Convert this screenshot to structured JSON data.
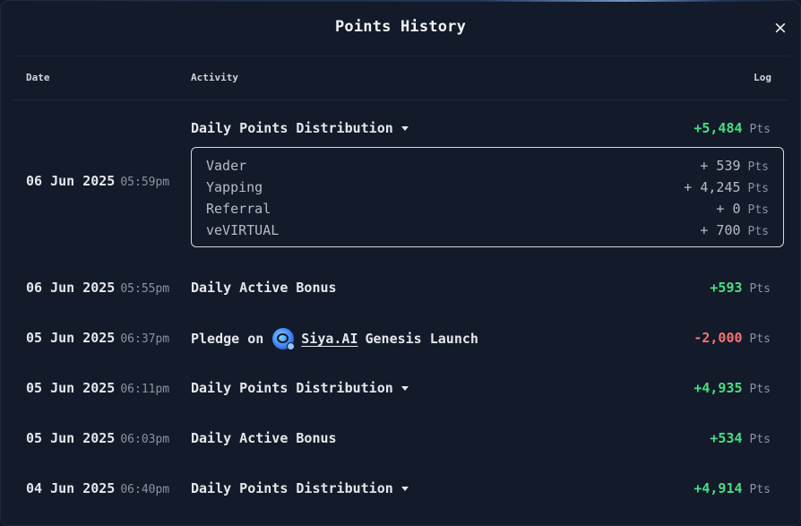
{
  "modal": {
    "title": "Points History",
    "close_label": "×"
  },
  "columns": {
    "date": "Date",
    "activity": "Activity",
    "log": "Log"
  },
  "unit": "Pts",
  "rows": [
    {
      "date": "06 Jun 2025",
      "time": "05:59pm",
      "activity": "Daily Points Distribution",
      "expandable": true,
      "expanded": true,
      "log": "+5,484",
      "sign": "positive",
      "breakdown": [
        {
          "label": "Vader",
          "value": "+ 539"
        },
        {
          "label": "Yapping",
          "value": "+ 4,245"
        },
        {
          "label": "Referral",
          "value": "+ 0"
        },
        {
          "label": "veVIRTUAL",
          "value": "+ 700"
        }
      ]
    },
    {
      "date": "06 Jun 2025",
      "time": "05:55pm",
      "activity": "Daily Active Bonus",
      "log": "+593",
      "sign": "positive"
    },
    {
      "date": "05 Jun 2025",
      "time": "06:37pm",
      "activity_prefix": "Pledge on",
      "activity_link": "Siya.AI",
      "activity_suffix": "Genesis Launch",
      "logo_icon": "siya-ai-logo-icon",
      "log": "-2,000",
      "sign": "negative"
    },
    {
      "date": "05 Jun 2025",
      "time": "06:11pm",
      "activity": "Daily Points Distribution",
      "expandable": true,
      "log": "+4,935",
      "sign": "positive"
    },
    {
      "date": "05 Jun 2025",
      "time": "06:03pm",
      "activity": "Daily Active Bonus",
      "log": "+534",
      "sign": "positive"
    },
    {
      "date": "04 Jun 2025",
      "time": "06:40pm",
      "activity": "Daily Points Distribution",
      "expandable": true,
      "log": "+4,914",
      "sign": "positive"
    }
  ],
  "colors": {
    "positive": "#4ade80",
    "negative": "#f87171",
    "background": "#131a2a"
  }
}
